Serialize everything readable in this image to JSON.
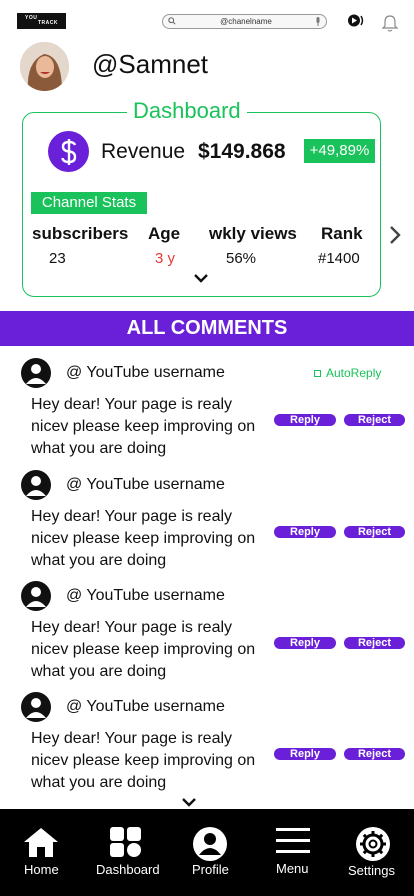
{
  "header": {
    "logo_line1": "YOU",
    "logo_line2": "TRACK",
    "search_value": "@chanelname"
  },
  "profile": {
    "handle": "@Samnet"
  },
  "dashboard": {
    "title": "Dashboard",
    "revenue_label": "Revenue",
    "revenue_value": "$149.868",
    "revenue_change": "+49,89%",
    "stats_tag": "Channel  Stats",
    "stats": [
      {
        "label": "subscribers",
        "value": "23"
      },
      {
        "label": "Age",
        "value": "3 y"
      },
      {
        "label": "wkly views",
        "value": "56%"
      },
      {
        "label": "Rank",
        "value": "#1400"
      }
    ]
  },
  "comments": {
    "title": "ALL COMMENTS",
    "autoreply_label": "AutoReply",
    "reply_label": "Reply",
    "reject_label": "Reject",
    "items": [
      {
        "user": "@ YouTube username",
        "text": "Hey dear! Your page  is realy nicev  please keep improving on what you are doing"
      },
      {
        "user": "@ YouTube username",
        "text": "Hey dear! Your page  is realy nicev  please keep improving on what you are doing"
      },
      {
        "user": "@ YouTube username",
        "text": "Hey dear! Your page  is realy nicev  please keep improving on what you are doing"
      },
      {
        "user": "@ YouTube username",
        "text": "Hey dear! Your page  is realy nicev  please keep improving on what you are doing"
      }
    ]
  },
  "nav": {
    "items": [
      {
        "label": "Home",
        "icon": "home-icon"
      },
      {
        "label": "Dashboard",
        "icon": "dashboard-grid-icon"
      },
      {
        "label": "Profile",
        "icon": "profile-icon"
      },
      {
        "label": "Menu",
        "icon": "menu-icon"
      },
      {
        "label": "Settings",
        "icon": "gear-icon"
      }
    ]
  },
  "colors": {
    "accent_purple": "#6a1fd8",
    "accent_green": "#19c25a",
    "age_red": "#e53935",
    "nav_bg": "#000000"
  }
}
